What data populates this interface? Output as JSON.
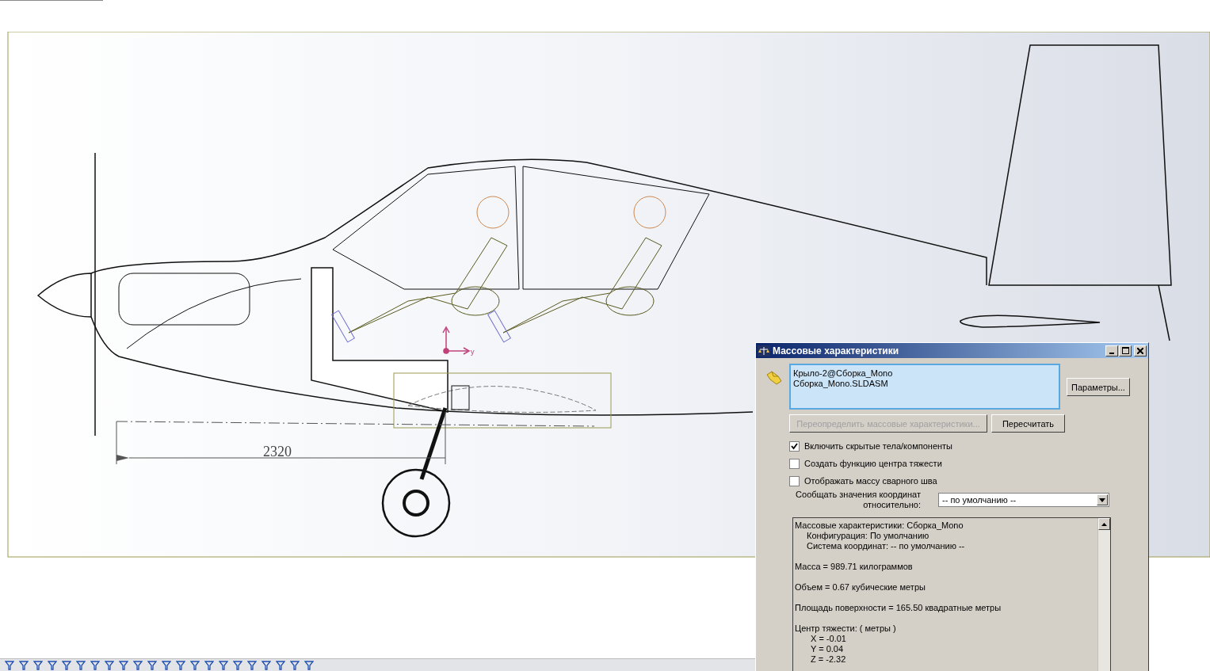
{
  "viewport": {
    "dimension_label": "2320",
    "axis_label": "y"
  },
  "dialog": {
    "title": "Массовые характеристики",
    "selection": [
      "Крыло-2@Сборка_Mono",
      "Сборка_Mono.SLDASM"
    ],
    "options_button": {
      "label": "Параметры...",
      "disabled": false
    },
    "actions": [
      {
        "label": "Переопределить массовые характеристики...",
        "disabled": true
      },
      {
        "label": "Пересчитать",
        "disabled": false
      }
    ],
    "checkboxes": [
      {
        "label": "Включить скрытые тела/компоненты",
        "checked": true
      },
      {
        "label": "Создать функцию центра тяжести",
        "checked": false
      },
      {
        "label": "Отображать массу сварного шва",
        "checked": false
      }
    ],
    "coordinate_label": "Сообщать значения координат\nотносительно:",
    "coordinate_select": {
      "value": "-- по умолчанию --"
    },
    "report": [
      {
        "text": "Массовые характеристики: Сборка_Mono",
        "children": [
          {
            "text": "Конфигурация: По умолчанию"
          },
          {
            "text": "Система координат: -- по умолчанию --"
          }
        ]
      },
      {
        "text": "Масса = 989.71 килограммов"
      },
      {
        "text": "Объем = 0.67 кубические метры"
      },
      {
        "text": "Площадь поверхности = 165.50 квадратные метры"
      },
      {
        "text": "Центр тяжести: ( метры )",
        "children": [
          {
            "text": "X = -0.01"
          },
          {
            "text": "Y = 0.04"
          },
          {
            "text": "Z = -2.32"
          }
        ]
      }
    ]
  }
}
